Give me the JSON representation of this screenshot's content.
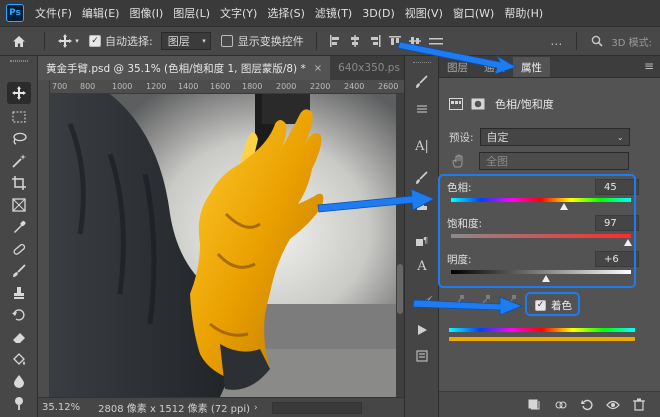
{
  "app": {
    "logo": "Ps"
  },
  "menubar": {
    "items": [
      "文件(F)",
      "编辑(E)",
      "图像(I)",
      "图层(L)",
      "文字(Y)",
      "选择(S)",
      "滤镜(T)",
      "3D(D)",
      "视图(V)",
      "窗口(W)",
      "帮助(H)"
    ]
  },
  "options": {
    "auto_select_label": "自动选择:",
    "auto_select_checked": true,
    "layer_dropdown_value": "图层",
    "transform_controls_label": "显示变换控件",
    "transform_controls_checked": false,
    "mode_3d_label": "3D 模式:"
  },
  "documents": {
    "active_tab": "黄金手臂.psd @ 35.1% (色相/饱和度 1, 图层蒙版/8) *",
    "close_glyph": "×",
    "inactive_tab": "640x350.ps"
  },
  "ruler": {
    "ticks": [
      "700",
      "800",
      "1000",
      "1200",
      "1400",
      "1600",
      "1800",
      "2000",
      "2200",
      "2400",
      "2600"
    ]
  },
  "status": {
    "zoom": "35.12%",
    "doc_info": "2808 像素 x 1512 像素 (72 ppi)"
  },
  "panel": {
    "tabs": [
      "图层",
      "通道",
      "属性"
    ],
    "active_tab": "属性",
    "adjustment_title": "色相/饱和度",
    "preset_label": "预设:",
    "preset_value": "自定",
    "channel_value": "全图",
    "sliders": [
      {
        "label": "色相:",
        "value": "45",
        "fraction": 0.625
      },
      {
        "label": "饱和度:",
        "value": "97",
        "fraction": 0.985
      },
      {
        "label": "明度:",
        "value": "+6",
        "fraction": 0.53
      }
    ],
    "colorize_label": "着色",
    "colorize_checked": true
  },
  "colors": {
    "accent": "#1e7cf0",
    "gold": "#f0a800",
    "menubar_bg": "#3a3a3a",
    "panel_bg": "#535353"
  }
}
